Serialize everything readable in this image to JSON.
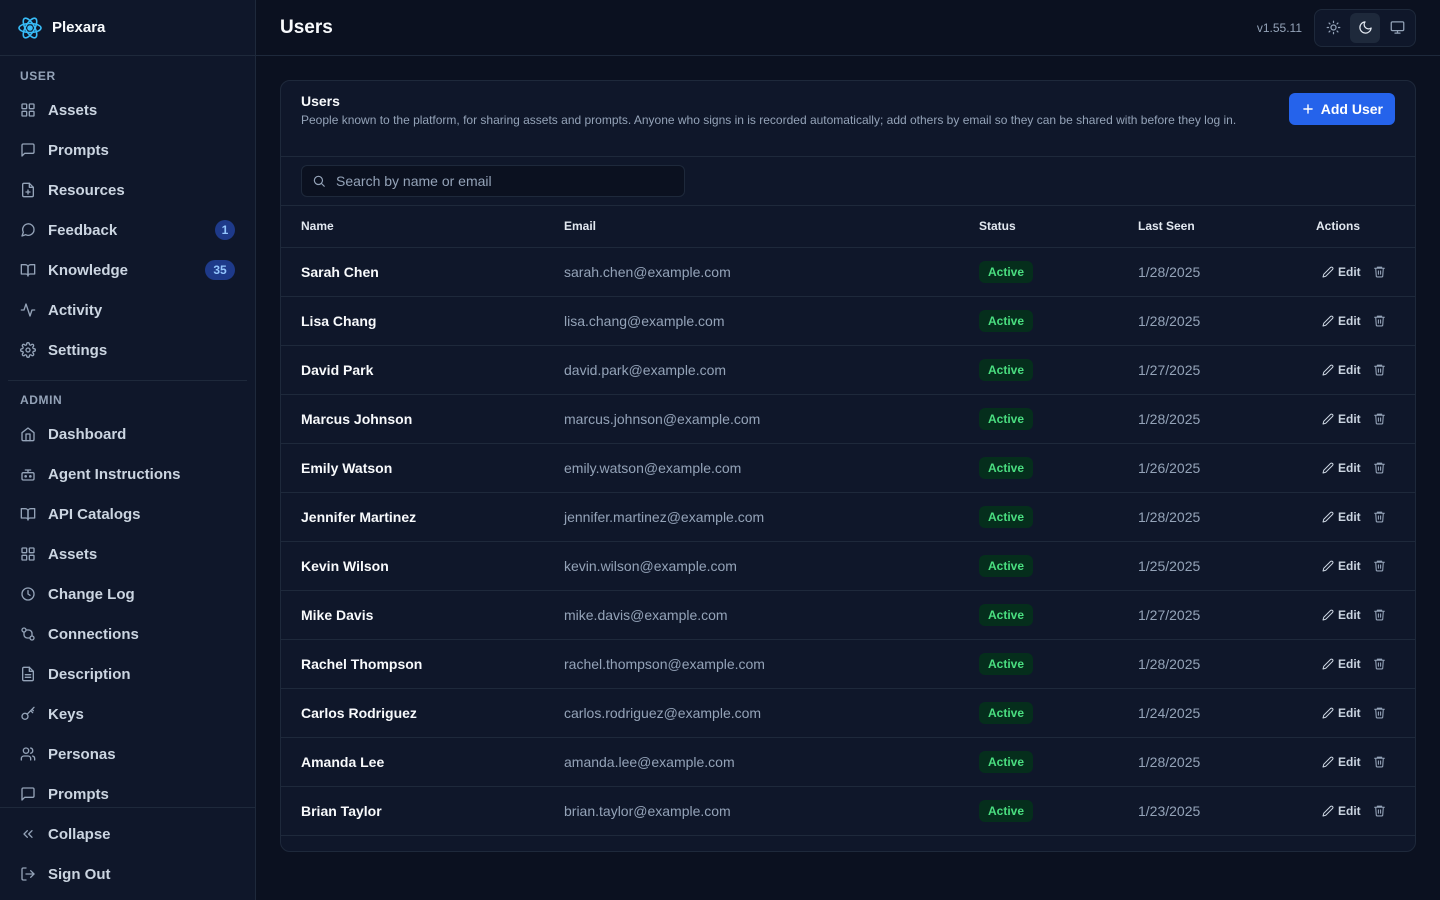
{
  "app": {
    "name": "Plexara",
    "version": "v1.55.11"
  },
  "header": {
    "title": "Users"
  },
  "sidebar": {
    "user_section": "USER",
    "user_items": [
      {
        "label": "Assets",
        "icon": "grid-icon"
      },
      {
        "label": "Prompts",
        "icon": "message-icon"
      },
      {
        "label": "Resources",
        "icon": "file-icon"
      },
      {
        "label": "Feedback",
        "icon": "chat-icon",
        "badge": "1"
      },
      {
        "label": "Knowledge",
        "icon": "book-icon",
        "badge": "35"
      },
      {
        "label": "Activity",
        "icon": "activity-icon"
      },
      {
        "label": "Settings",
        "icon": "gear-icon"
      }
    ],
    "admin_section": "ADMIN",
    "admin_items": [
      {
        "label": "Dashboard",
        "icon": "home-icon"
      },
      {
        "label": "Agent Instructions",
        "icon": "bot-icon"
      },
      {
        "label": "API Catalogs",
        "icon": "book-icon"
      },
      {
        "label": "Assets",
        "icon": "grid-icon"
      },
      {
        "label": "Change Log",
        "icon": "clock-icon"
      },
      {
        "label": "Connections",
        "icon": "connections-icon"
      },
      {
        "label": "Description",
        "icon": "document-icon"
      },
      {
        "label": "Keys",
        "icon": "key-icon"
      },
      {
        "label": "Personas",
        "icon": "users-icon"
      },
      {
        "label": "Prompts",
        "icon": "message-icon"
      }
    ],
    "collapse": "Collapse",
    "sign_out": "Sign Out"
  },
  "card": {
    "title": "Users",
    "description": "People known to the platform, for sharing assets and prompts. Anyone who signs in is recorded automatically; add others by email so they can be shared with before they log in.",
    "add_button": "Add User",
    "search_placeholder": "Search by name or email"
  },
  "table": {
    "columns": [
      "Name",
      "Email",
      "Status",
      "Last Seen",
      "Actions"
    ],
    "edit_label": "Edit",
    "rows": [
      {
        "name": "Sarah Chen",
        "email": "sarah.chen@example.com",
        "status": "Active",
        "last_seen": "1/28/2025"
      },
      {
        "name": "Lisa Chang",
        "email": "lisa.chang@example.com",
        "status": "Active",
        "last_seen": "1/28/2025"
      },
      {
        "name": "David Park",
        "email": "david.park@example.com",
        "status": "Active",
        "last_seen": "1/27/2025"
      },
      {
        "name": "Marcus Johnson",
        "email": "marcus.johnson@example.com",
        "status": "Active",
        "last_seen": "1/28/2025"
      },
      {
        "name": "Emily Watson",
        "email": "emily.watson@example.com",
        "status": "Active",
        "last_seen": "1/26/2025"
      },
      {
        "name": "Jennifer Martinez",
        "email": "jennifer.martinez@example.com",
        "status": "Active",
        "last_seen": "1/28/2025"
      },
      {
        "name": "Kevin Wilson",
        "email": "kevin.wilson@example.com",
        "status": "Active",
        "last_seen": "1/25/2025"
      },
      {
        "name": "Mike Davis",
        "email": "mike.davis@example.com",
        "status": "Active",
        "last_seen": "1/27/2025"
      },
      {
        "name": "Rachel Thompson",
        "email": "rachel.thompson@example.com",
        "status": "Active",
        "last_seen": "1/28/2025"
      },
      {
        "name": "Carlos Rodriguez",
        "email": "carlos.rodriguez@example.com",
        "status": "Active",
        "last_seen": "1/24/2025"
      },
      {
        "name": "Amanda Lee",
        "email": "amanda.lee@example.com",
        "status": "Active",
        "last_seen": "1/28/2025"
      },
      {
        "name": "Brian Taylor",
        "email": "brian.taylor@example.com",
        "status": "Active",
        "last_seen": "1/23/2025"
      }
    ]
  },
  "colors": {
    "accent": "#2563eb",
    "active_status": "#4ade80",
    "background": "#0b1120"
  }
}
